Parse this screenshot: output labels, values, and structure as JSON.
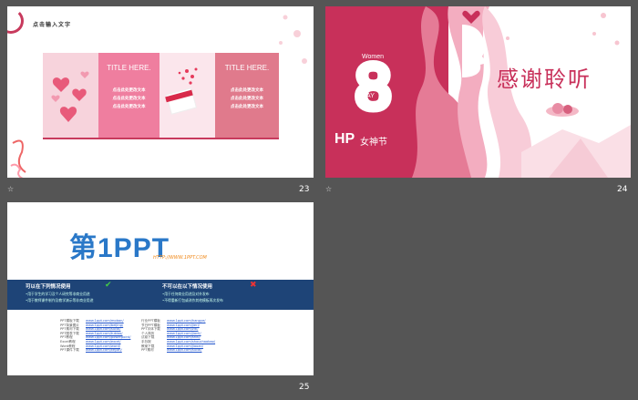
{
  "slides": [
    {
      "number": "23",
      "header": "点击输入文字",
      "title1": "TITLE HERE.",
      "title2": "TITLE HERE.",
      "text_lines": [
        "点击此处更改文本",
        "点击此处更改文本",
        "点击此处更改文本"
      ]
    },
    {
      "number": "24",
      "women": "Women",
      "day": "DAY",
      "hp": "HP",
      "festival": "女神节",
      "thanks": "感谢聆听"
    },
    {
      "number": "25",
      "logo_main": "第1PPT",
      "logo_url": "HTTP://WWW.1PPT.COM",
      "can_use_title": "可以在下列情况使用",
      "can_use_lines": [
        "•用于学生的学习及个人研究等非商业用途",
        "•用于教师课件制作及教学演示等非商业用途"
      ],
      "cannot_use_title": "不可以在以下情况使用",
      "cannot_use_lines": [
        "•用于任何商业用途及对外发布",
        "•不得重新打包或改作其他模板再次发布"
      ],
      "links_left_labels": [
        "PPT模板下载",
        "PPT背景图片",
        "PPT素材下载",
        "PPT图表下载",
        "PPT教程",
        "Excel教程",
        "Word教程",
        "PPT课件下载"
      ],
      "links_left_urls": [
        "www.1ppt.com/moban/",
        "www.1ppt.com/beijing/",
        "www.1ppt.com/sucai/",
        "www.1ppt.com/tubiao/",
        "www.1ppt.com/powerpoint/",
        "www.1ppt.com/excel/",
        "www.1ppt.com/word/",
        "www.1ppt.com/kejian/"
      ],
      "links_right_labels": [
        "行业PPT模板",
        "节日PPT模板",
        "PPT字体下载",
        "个人简历",
        "试卷下载",
        "手抄报",
        "教案下载",
        "PPT素材"
      ],
      "links_right_urls": [
        "www.1ppt.com/hangye/",
        "www.1ppt.com/jieri/",
        "www.1ppt.com/ziti/",
        "www.1ppt.com/jianli/",
        "www.1ppt.com/shiti/",
        "www.1ppt.com/shouchaobao/",
        "www.1ppt.com/jiaoan/",
        "www.1ppt.com/sucai/"
      ]
    }
  ],
  "colors": {
    "accent": "#c83a5d",
    "pink_light": "#f4b8c6",
    "pink_mid": "#e8809c",
    "navy": "#1e4477",
    "logo_blue": "#2a78c8",
    "logo_orange": "#f08a1c"
  },
  "icons": {
    "star": "☆"
  }
}
